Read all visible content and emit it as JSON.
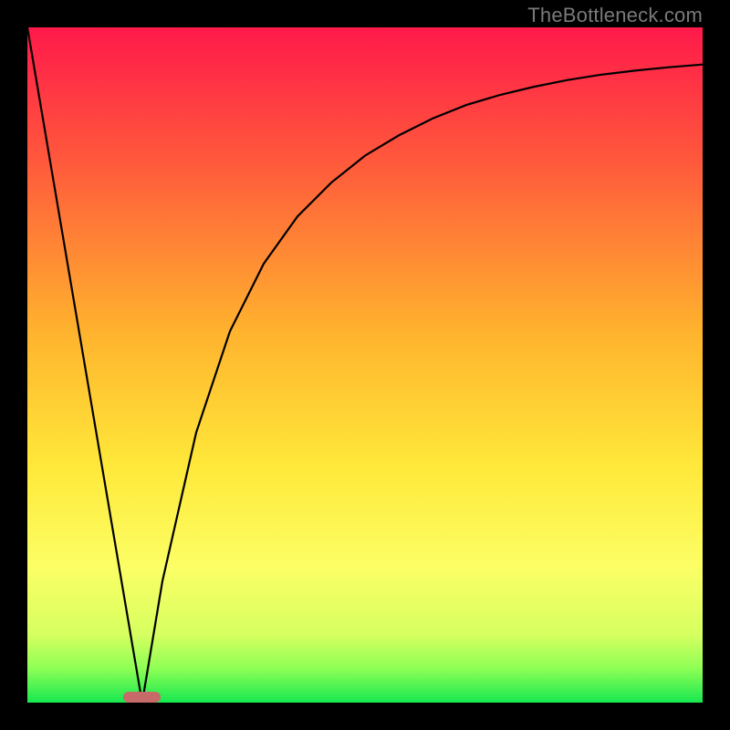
{
  "watermark": "TheBottleneck.com",
  "chart_data": {
    "type": "line",
    "title": "",
    "xlabel": "",
    "ylabel": "",
    "xlim": [
      0,
      100
    ],
    "ylim": [
      0,
      100
    ],
    "grid": false,
    "legend": false,
    "curve_description": "V-shaped bottleneck curve: steep linear descent from top-left to a minimum near x≈17, then a smooth asymptotic rise toward top-right",
    "series": [
      {
        "name": "left-branch",
        "x": [
          0,
          17
        ],
        "y": [
          100,
          0
        ]
      },
      {
        "name": "right-branch",
        "x": [
          17,
          20,
          25,
          30,
          35,
          40,
          45,
          50,
          55,
          60,
          65,
          70,
          75,
          80,
          85,
          90,
          95,
          100
        ],
        "y": [
          0,
          18,
          40,
          55,
          65,
          72,
          77,
          81,
          84,
          86.5,
          88.5,
          90,
          91.2,
          92.2,
          93,
          93.6,
          94.1,
          94.5
        ]
      }
    ],
    "marker": {
      "name": "optimal-range",
      "x_center": 17,
      "width_pct": 5.5,
      "color": "#c76a6a"
    },
    "gradient_bands": [
      {
        "y_pct": 0,
        "color": "#ff1a4b"
      },
      {
        "y_pct": 20,
        "color": "#ff5a3c"
      },
      {
        "y_pct": 45,
        "color": "#ffb32e"
      },
      {
        "y_pct": 65,
        "color": "#ffe93a"
      },
      {
        "y_pct": 80,
        "color": "#fcff66"
      },
      {
        "y_pct": 90,
        "color": "#d6ff60"
      },
      {
        "y_pct": 95,
        "color": "#8dff55"
      },
      {
        "y_pct": 100,
        "color": "#16e850"
      }
    ]
  }
}
